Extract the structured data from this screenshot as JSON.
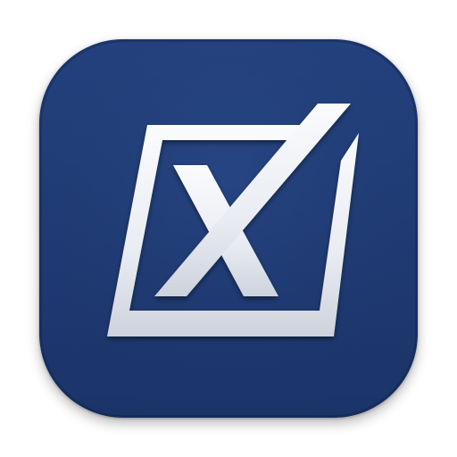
{
  "icon": {
    "name": "checkbox-x-app-icon",
    "glyph": "X",
    "colors": {
      "background_top": "#24427f",
      "background_bottom": "#1b3468",
      "mark_light": "#f4f6fa",
      "mark_shade": "#c9ced8",
      "rim": "#0f1f45"
    }
  }
}
